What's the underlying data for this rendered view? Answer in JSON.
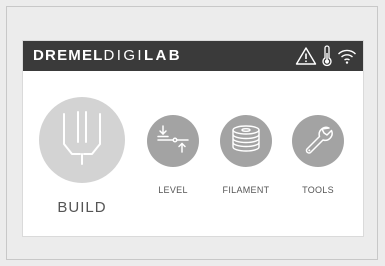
{
  "header": {
    "brand_bold": "DREMEL",
    "brand_light": "DIGI",
    "brand_bold2": "LAB",
    "status_icons": [
      "warning-icon",
      "thermometer-icon",
      "wifi-icon"
    ]
  },
  "tiles": {
    "build": {
      "label": "BUILD",
      "icon": "nozzle-icon"
    },
    "level": {
      "label": "LEVEL",
      "icon": "level-icon"
    },
    "filament": {
      "label": "FILAMENT",
      "icon": "filament-spool-icon"
    },
    "tools": {
      "label": "TOOLS",
      "icon": "wrench-icon"
    }
  },
  "colors": {
    "header_bg": "#3a3a3a",
    "circle": "#a3a3a3",
    "build_circle": "#d3d3d3",
    "text": "#555555"
  }
}
